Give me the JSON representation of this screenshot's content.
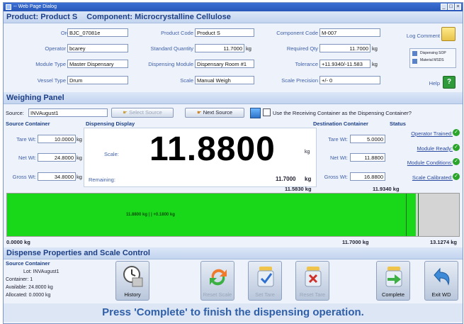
{
  "window": {
    "title": "-- Web Page Dialog"
  },
  "header": {
    "product_label": "Product: Product S",
    "component_label": "Component: Microcrystalline Cellulose"
  },
  "info": {
    "order": {
      "label": "Order",
      "value": "BJC_07081e"
    },
    "operator": {
      "label": "Operator",
      "value": "bcarey"
    },
    "module_type": {
      "label": "Module Type",
      "value": "Master Dispensary"
    },
    "vessel_type": {
      "label": "Vessel Type",
      "value": "Drum"
    },
    "product_code": {
      "label": "Product Code",
      "value": "Product S"
    },
    "standard_quantity": {
      "label": "Standard Quantity",
      "value": "11.7000",
      "unit": "kg"
    },
    "dispensing_module": {
      "label": "Dispensing Module",
      "value": "Dispensary Room #1"
    },
    "scale": {
      "label": "Scale",
      "value": "Manual Weigh"
    },
    "component_code": {
      "label": "Component Code",
      "value": "M-007"
    },
    "required_qty": {
      "label": "Required Qty",
      "value": "11.7000",
      "unit": "kg"
    },
    "tolerance": {
      "label": "Tolerance",
      "value": "+11.9340/-11.583",
      "unit": "kg"
    },
    "scale_precision": {
      "label": "Scale Precision",
      "value": "+/- 0"
    },
    "log_comment": {
      "label": "Log Comment"
    },
    "help": {
      "label": "Help"
    },
    "doc_list": [
      "Dispensing SOP",
      "Material MSDS"
    ]
  },
  "weighing": {
    "title": "Weighing Panel",
    "source_label": "Source:",
    "source_value": "INVAugust1",
    "select_source": "Select Source",
    "next_source": "Next Source",
    "receiving_check": "Use the Receiving Container as the Dispensing Container?",
    "source_container": {
      "title": "Source Container",
      "tare": {
        "label": "Tare Wt:",
        "value": "10.0000",
        "unit": "kg"
      },
      "net": {
        "label": "Net Wt:",
        "value": "24.8000",
        "unit": "kg"
      },
      "gross": {
        "label": "Gross Wt:",
        "value": "34.8000",
        "unit": "kg"
      }
    },
    "display": {
      "title": "Dispensing Display",
      "scale_label": "Scale:",
      "reading": "11.8800",
      "reading_unit": "kg",
      "remaining_label": "Remaining:",
      "target": "11.7000",
      "target_unit": "kg"
    },
    "destination_container": {
      "title": "Destination Container",
      "tare": {
        "label": "Tare Wt:",
        "value": "5.0000"
      },
      "net": {
        "label": "Net Wt:",
        "value": "11.8800"
      },
      "gross": {
        "label": "Gross Wt:",
        "value": "16.8800"
      }
    },
    "status": {
      "title": "Status",
      "items": [
        "Operator Trained:",
        "Module Ready:",
        "Module Conditions:",
        "Scale Calibrated:"
      ]
    }
  },
  "bar": {
    "lower_tol_label": "11.5830 kg",
    "upper_tol_label": "11.9340 kg",
    "fill_text": "11.8800 kg | | +0.1800 kg",
    "min_label": "0.0000 kg",
    "target_label": "11.7000 kg",
    "max_label": "13.1274 kg",
    "fill_fraction": 0.905,
    "lower_fraction": 0.882,
    "upper_fraction": 0.909,
    "fill_color": "#19d719"
  },
  "dispense": {
    "title": "Dispense Properties and Scale Control",
    "source_title": "Source Container",
    "lot": "Lot: INVAugust1",
    "container": "Container: 1",
    "available": "Available: 24.8000 kg",
    "allocated": "Allocated: 0.0000 kg",
    "buttons": {
      "history": "History",
      "reset_scale": "Reset Scale",
      "set_tare": "Set Tare",
      "reset_tare": "Reset Tare",
      "complete": "Complete",
      "exit": "Exit WD"
    },
    "instruction": "Press 'Complete' to finish the dispensing operation."
  }
}
